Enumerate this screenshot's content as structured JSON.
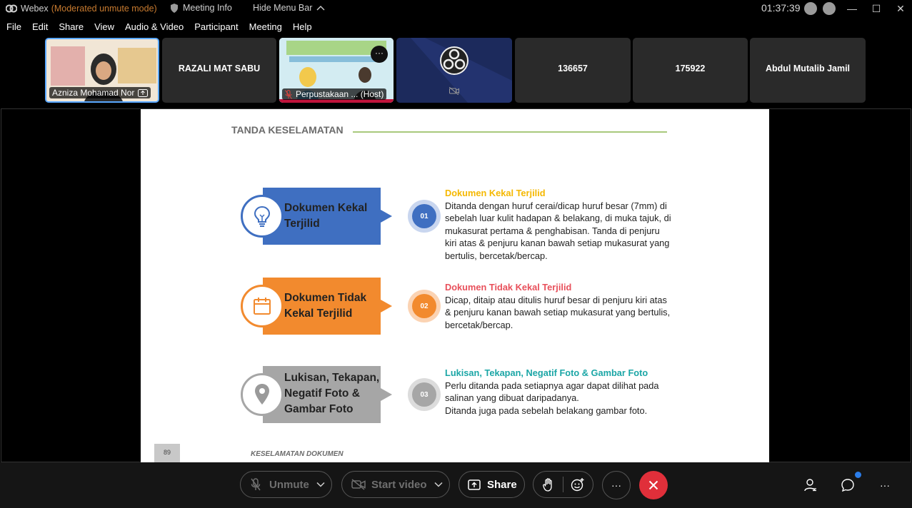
{
  "titlebar": {
    "app_name": "Webex",
    "mode": "(Moderated unmute mode)",
    "meeting_info": "Meeting Info",
    "hide_menu": "Hide Menu Bar",
    "clock": "01:37:39"
  },
  "menu": [
    "File",
    "Edit",
    "Share",
    "View",
    "Audio & Video",
    "Participant",
    "Meeting",
    "Help"
  ],
  "participants": [
    {
      "name": "Azniza Mohamad Nor"
    },
    {
      "name": "RAZALI MAT SABU"
    },
    {
      "name": "Perpustakaan ... (Host)"
    },
    {
      "name": ""
    },
    {
      "name": "136657"
    },
    {
      "name": "175922"
    },
    {
      "name": "Abdul Mutalib Jamil"
    }
  ],
  "slide": {
    "title": "TANDA KESELAMATAN",
    "items": [
      {
        "label_1": "Dokumen Kekal",
        "label_2": "Terjilid",
        "num": "01",
        "heading": "Dokumen Kekal Terjilid",
        "heading_color": "#f5b800",
        "bar_color": "#3f6fc1",
        "text": "Ditanda dengan huruf cerai/dicap huruf besar (7mm) di sebelah luar kulit hadapan & belakang, di muka tajuk, di mukasurat pertama & penghabisan. Tanda di penjuru kiri atas & penjuru kanan bawah setiap mukasurat yang bertulis, bercetak/bercap.",
        "icon": "lightbulb-icon"
      },
      {
        "label_1": "Dokumen Tidak",
        "label_2": "Kekal Terjilid",
        "num": "02",
        "heading": "Dokumen Tidak Kekal Terjilid",
        "heading_color": "#e8505b",
        "bar_color": "#f28a2e",
        "text": "Dicap, ditaip atau ditulis huruf besar di penjuru kiri atas & penjuru kanan bawah setiap mukasurat yang bertulis, bercetak/bercap.",
        "icon": "calendar-icon"
      },
      {
        "label_1": "Lukisan, Tekapan,",
        "label_2": "Negatif Foto &",
        "label_3": "Gambar Foto",
        "num": "03",
        "heading": "Lukisan, Tekapan, Negatif Foto & Gambar Foto",
        "heading_color": "#1ba6a6",
        "bar_color": "#a6a6a6",
        "text": "Perlu ditanda pada setiapnya agar dapat dilihat pada salinan yang dibuat daripadanya.",
        "text_2": "Ditanda juga pada sebelah belakang gambar foto.",
        "icon": "map-pin-icon"
      }
    ],
    "page_number": "89",
    "footer": "KESELAMATAN DOKUMEN"
  },
  "toolbar": {
    "unmute": "Unmute",
    "start_video": "Start video",
    "share": "Share",
    "end_color": "#e02f3a"
  }
}
